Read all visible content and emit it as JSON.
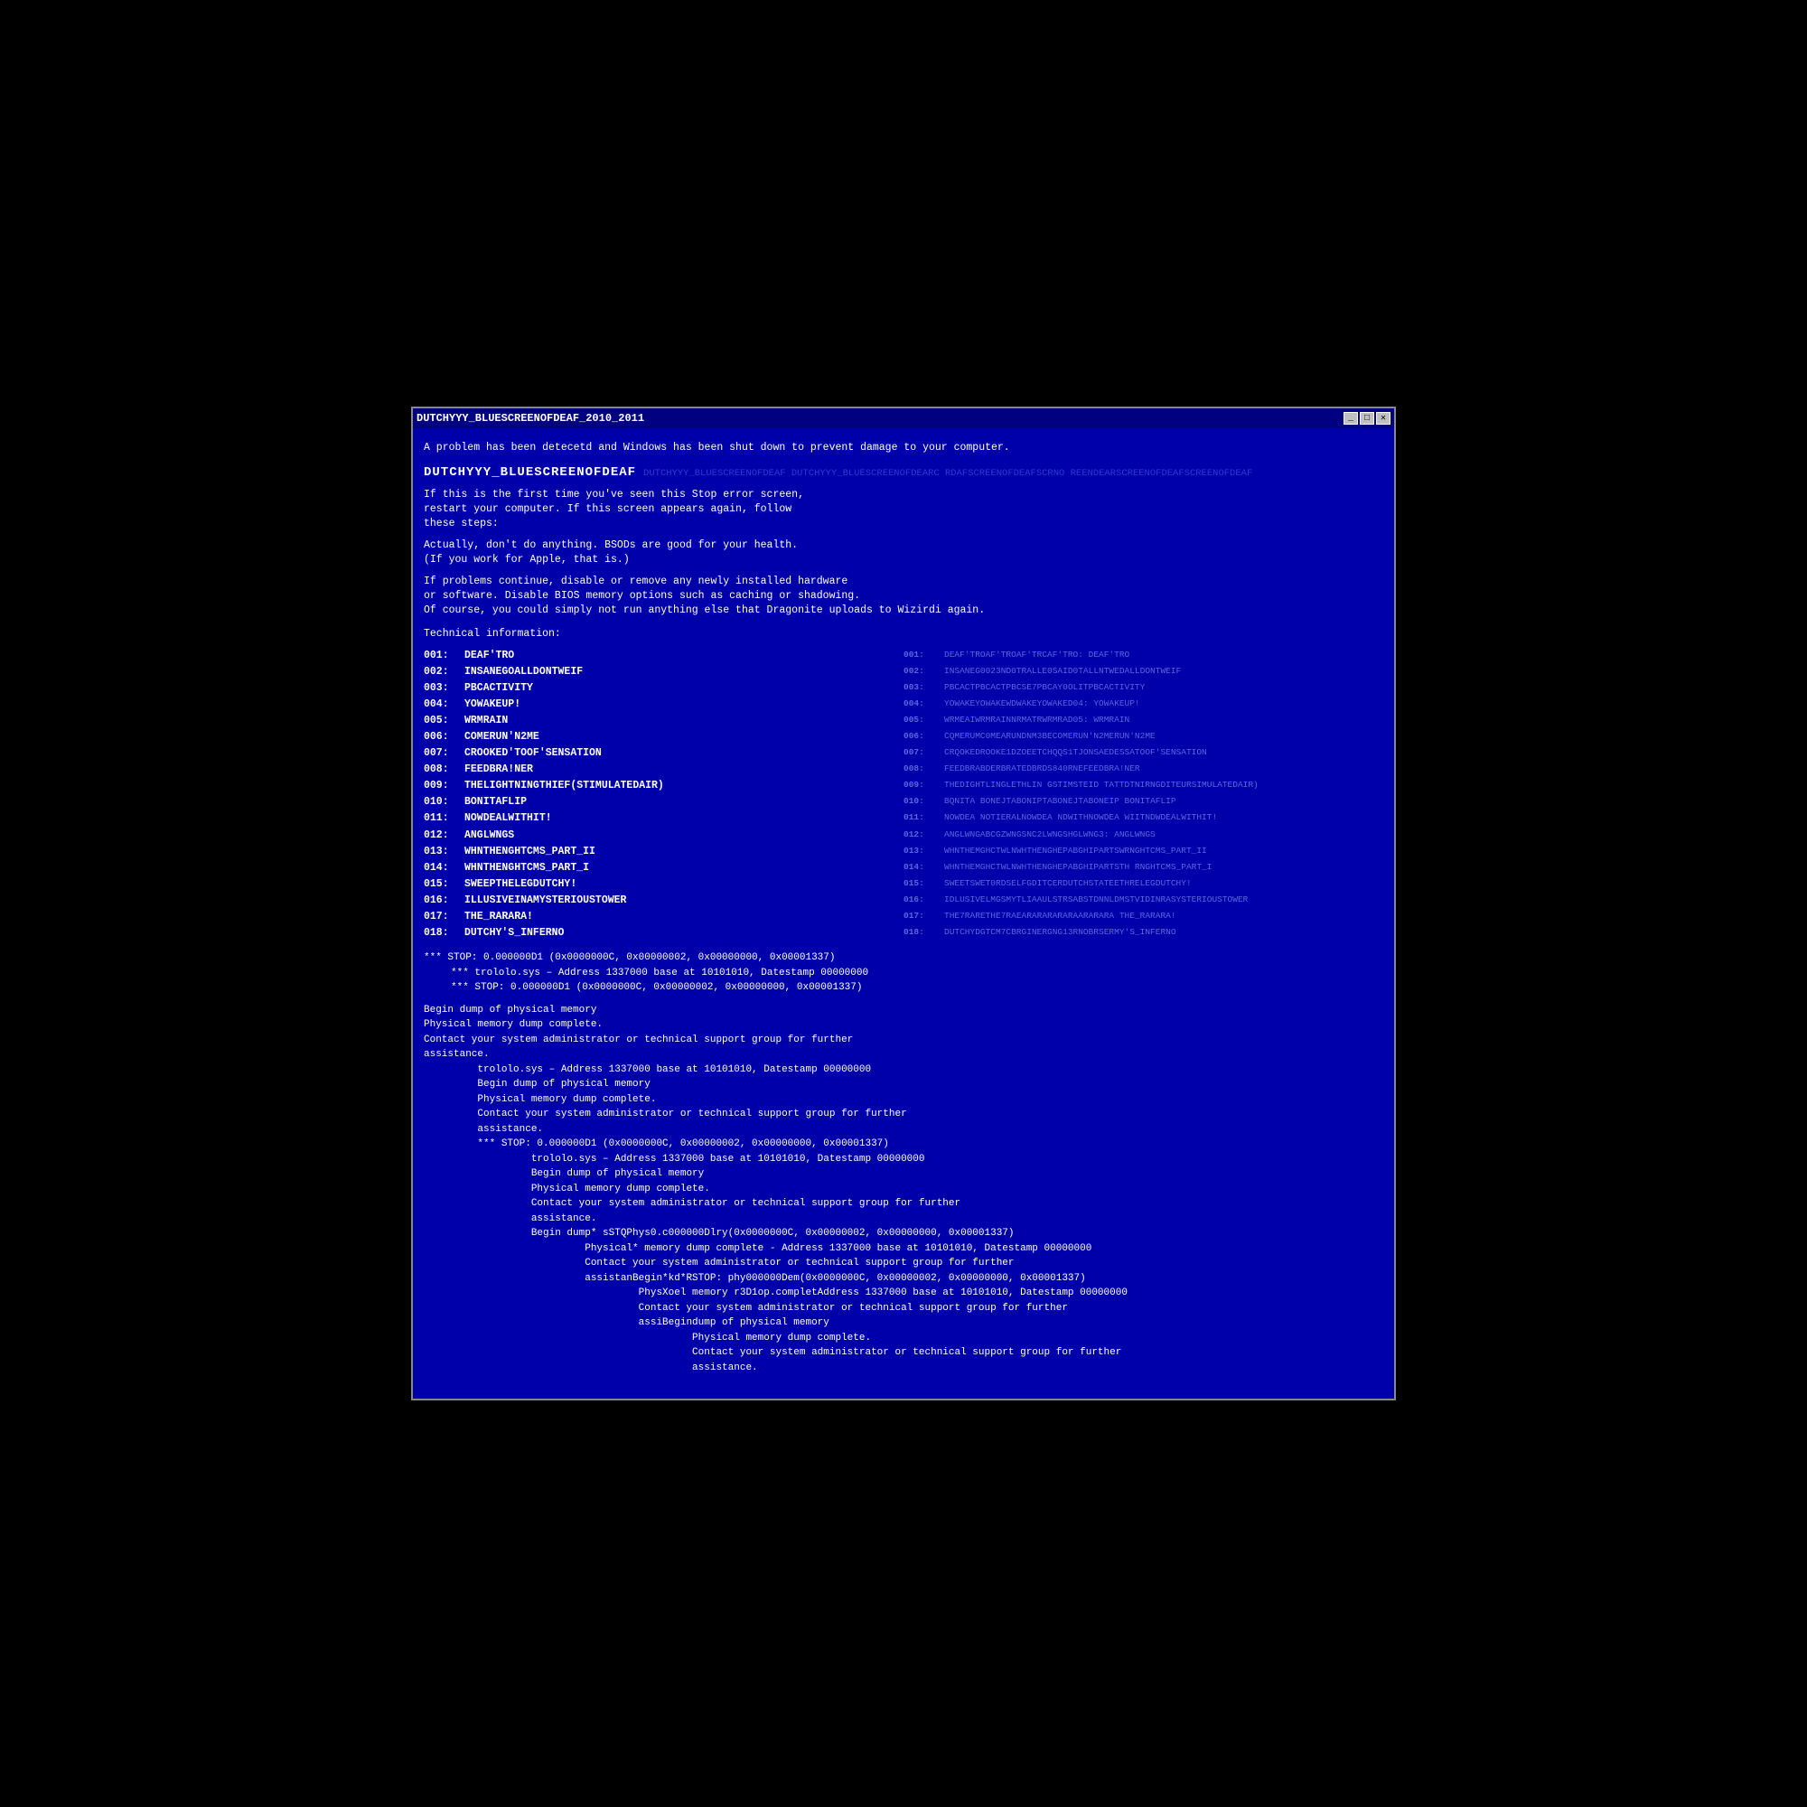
{
  "window": {
    "title": "DUTCHYYY_BLUESCREENOFDEAF_2010_2011",
    "buttons": [
      "_",
      "□",
      "✕"
    ]
  },
  "bsod": {
    "intro": "A problem has been detecetd and Windows has been shut down to prevent damage\nto your computer.",
    "main_title": "DUTCHYYY_BLUESCREENOFDEAF",
    "main_title_ghost": "DUTCHYYY_BLUESCREENOFDEAF DUTCHYYY_BLUESCREENOFDEA RCRDAFSCREENOFDEAFSCREENOFDEAFSCREENDEARSCREENCEARSCREENOFDEAF",
    "first_time": "If this is the first time you've seen this Stop error screen,\nrestart your computer. If this screen appears again, follow\nthese steps:",
    "advice": "Actually, don't do anything. BSODs are good for your health.\n(If you work for Apple, that is.)",
    "if_problems": "If problems continue, disable or remove any newly installed hardware\nor software. Disable BIOS memory options such as caching or shadowing.\nOf course, you could simply not run anything else that Dragonite uploads to Wizirdi again.",
    "tech_info_label": "Technical information:",
    "items_left": [
      {
        "num": "001:",
        "name": "DEAF'TRO"
      },
      {
        "num": "002:",
        "name": "INSANEGOALLDONTWEIF"
      },
      {
        "num": "003:",
        "name": "PBCACTIVITY"
      },
      {
        "num": "004:",
        "name": "YOWAKEUP!"
      },
      {
        "num": "005:",
        "name": "WRMRAIN"
      },
      {
        "num": "006:",
        "name": "COMERUN'N2ME"
      },
      {
        "num": "007:",
        "name": "CROOKED'TOOF'SENSATION"
      },
      {
        "num": "008:",
        "name": "FEEDBRA!NER"
      },
      {
        "num": "009:",
        "name": "THELIGHTNINGTHIEF(STIMULATEDAIR)"
      },
      {
        "num": "010:",
        "name": "BONITAFLIP"
      },
      {
        "num": "011:",
        "name": "NOWDEALWITHIT!"
      },
      {
        "num": "012:",
        "name": "ANGLWNGS"
      },
      {
        "num": "013:",
        "name": "WHNTHENGHTCMS_PART_II"
      },
      {
        "num": "014:",
        "name": "WHNTHENGHTCMS_PART_I"
      },
      {
        "num": "015:",
        "name": "SWEEPTHELEGDUTCHY!"
      },
      {
        "num": "016:",
        "name": "ILLUSIVEINAMYSTERIOUSTOWER"
      },
      {
        "num": "017:",
        "name": "THE_RARARA!"
      },
      {
        "num": "018:",
        "name": "DUTCHY'S_INFERNO"
      }
    ],
    "items_right": [
      {
        "num": "001:",
        "name": "DEAF'TROAF'TROAF'TRCAF'TRO: DEAF'TRO"
      },
      {
        "num": "002:",
        "name": "INSANEG0023ND0TRALLE0SAID0TALLNTWEDALLDONTWEIF"
      },
      {
        "num": "003:",
        "name": "PBCACTPBCACTPBCSE7PBCAY0OLITPBCACTIVITY"
      },
      {
        "num": "004:",
        "name": "YOWAKEYOWAKEWDWAKEYOWAKED04: YOWAKEUP!"
      },
      {
        "num": "005:",
        "name": "WRMEAIWRMRAINNRMATRWRMRAD05: WRMRAIN"
      },
      {
        "num": "006:",
        "name": "CQMERUMC0MEARUNDNM3BECOMERUN'N2MERUN'N2ME"
      },
      {
        "num": "007:",
        "name": "CRQOKEDROOKE1DZOEETCHQQS1TJONSAEDESSATOOF'SENSATION"
      },
      {
        "num": "008:",
        "name": "FEEDBRABDERBRATEDBRDS840RNEFEEDBRA!NER"
      },
      {
        "num": "009:",
        "name": "THEDIGHTLINGLETHLIN GSTIMSTEID TATTDTNIRNGDITEURSIMULATEDAIR)"
      },
      {
        "num": "010:",
        "name": "BQNITA BONEJTABONIPTABONEJTABONEIP BONITAFLIP"
      },
      {
        "num": "011:",
        "name": "NOWDEA NOTIERALNOWDEA NDWITHNOWDEA WIITNDWDEALWITHIT!"
      },
      {
        "num": "012:",
        "name": "ANGLWNGABCGZWNGSNC2LWNGSHGLWNG3: ANGLWNGS"
      },
      {
        "num": "013:",
        "name": "WHNTHEMGHCTWLNWHTHENGHEPABGHIPARTSWRNGHTCMS_PART_II"
      },
      {
        "num": "014:",
        "name": "WHNTHEMGHCTWLNWHTHENGHEPABGHIPARTSTH RNGHTCMS_PART_I"
      },
      {
        "num": "015:",
        "name": "SWEETSWET0RDSELFGDITCERDUTCHSTATEETHRELEGDUTCHY!"
      },
      {
        "num": "016:",
        "name": "IDLUSIVELMGSMYTLIAAULSTRSABSTDNNLDMSTVIDINRASYSTERIOUSTOWER"
      },
      {
        "num": "017:",
        "name": "THE7RARETHE7RAEARARARARARAARARARA THE_RARARA!"
      },
      {
        "num": "018:",
        "name": "DUTCHYDGTCM7CBRGINERGNG13RNOBRSERMY'S_INFERNO"
      }
    ],
    "stop_line": "*** STOP: 0.000000D1 (0x0000000C, 0x00000002, 0x00000000, 0x00001337)",
    "trololo_line": "***      trololo.sys – Address 1337000 base at 10101010, Datestamp 00000000",
    "stop_line2": "*** STOP: 0.000000D1 (0x0000000C, 0x00000002, 0x00000000, 0x00001337)",
    "dump_lines": [
      "Begin dump of physical memory",
      "Physical memory dump complete.",
      "Contact your system administrator or technical support group for further",
      "assistance.",
      "         trololo.sys – Address 1337000 base at 10101010, Datestamp 00000000",
      "         Begin dump of physical memory",
      "         Physical memory dump complete.",
      "         Contact your system administrator or technical support group for further",
      "         assistance.",
      "         *** STOP: 0.000000D1 (0x0000000C, 0x00000002, 0x00000000, 0x00001337)",
      "                  trololo.sys – Address 1337000 base at 10101010, Datestamp 00000000",
      "                  Begin dump of physical memory",
      "                  Physical memory dump complete.",
      "                  Contact your system administrator or technical support group for further",
      "                  assistance.",
      "                  Begin dump* sSTQPhys0.c000000Dlry(0x0000000C, 0x00000002, 0x00000000, 0x00001337)",
      "                           Physical* memory dump complete - Address 1337000 base at 10101010, Datestamp 00000000",
      "                           Contact your system administrator or technical support group for further",
      "                           assistanBegin*kd*RSTOP: phy000000Dem(0x0000000C, 0x00000002, 0x00000000, 0x00001337)",
      "                                    PhysXoel memory r3D1op.completAddress 1337000 base at 10101010, Datestamp 00000000",
      "                                    Contact your system administrator or technical support group for further",
      "                                    assiBegindump of physical memory",
      "                                             Physical memory dump complete.",
      "                                             Contact your system administrator or technical support group for further",
      "                                             assistance."
    ]
  }
}
